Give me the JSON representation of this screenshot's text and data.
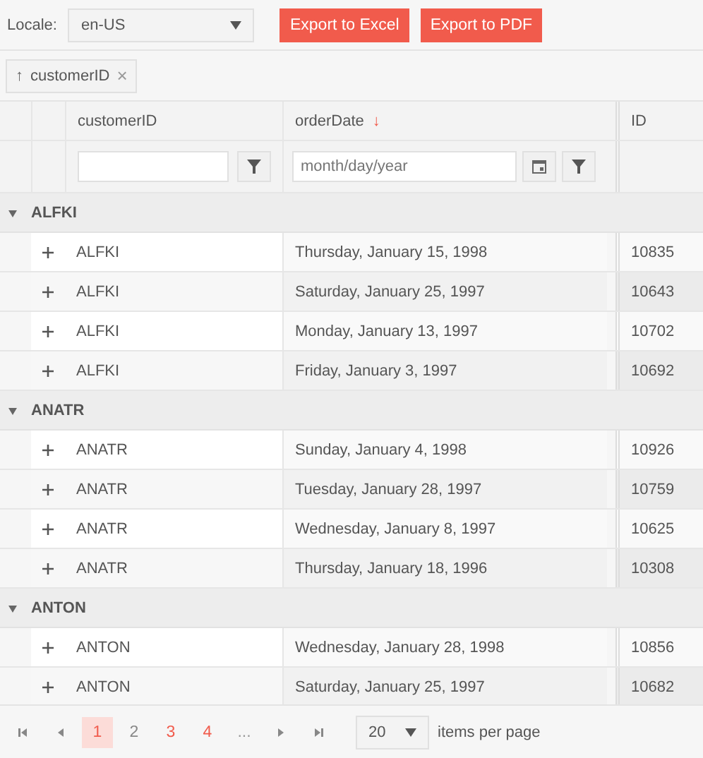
{
  "toolbar": {
    "locale_label": "Locale:",
    "locale_value": "en-US",
    "buttons": [
      "Export to Excel",
      "Export to PDF"
    ]
  },
  "group_panel": {
    "chips": [
      {
        "label": "customerID",
        "sort_icon": "↑",
        "remove_icon": "×"
      }
    ]
  },
  "columns": [
    {
      "title": "customerID"
    },
    {
      "title": "orderDate",
      "sort_icon": "↓"
    },
    {
      "title": "ID"
    }
  ],
  "filters": {
    "orderDate": {
      "placeholder": "month/day/year"
    }
  },
  "groups": [
    {
      "name": "ALFKI",
      "expanded": true,
      "rows": [
        {
          "customer": "ALFKI",
          "date": "Thursday, January 15, 1998",
          "id": "10835"
        },
        {
          "customer": "ALFKI",
          "date": "Saturday, January 25, 1997",
          "id": "10643"
        },
        {
          "customer": "ALFKI",
          "date": "Monday, January 13, 1997",
          "id": "10702"
        },
        {
          "customer": "ALFKI",
          "date": "Friday, January 3, 1997",
          "id": "10692"
        }
      ]
    },
    {
      "name": "ANATR",
      "expanded": true,
      "rows": [
        {
          "customer": "ANATR",
          "date": "Sunday, January 4, 1998",
          "id": "10926"
        },
        {
          "customer": "ANATR",
          "date": "Tuesday, January 28, 1997",
          "id": "10759"
        },
        {
          "customer": "ANATR",
          "date": "Wednesday, January 8, 1997",
          "id": "10625"
        },
        {
          "customer": "ANATR",
          "date": "Thursday, January 18, 1996",
          "id": "10308"
        }
      ]
    },
    {
      "name": "ANTON",
      "expanded": true,
      "rows": [
        {
          "customer": "ANTON",
          "date": "Wednesday, January 28, 1998",
          "id": "10856"
        },
        {
          "customer": "ANTON",
          "date": "Saturday, January 25, 1997",
          "id": "10682"
        }
      ]
    }
  ],
  "pager": {
    "pages": [
      {
        "label": "1",
        "selected": true,
        "color": "#f15b4c"
      },
      {
        "label": "2",
        "selected": false,
        "color": "#888888"
      },
      {
        "label": "3",
        "selected": false,
        "color": "#f15b4c"
      },
      {
        "label": "4",
        "selected": false,
        "color": "#f15b4c"
      }
    ],
    "more": "...",
    "page_size": "20",
    "page_size_label": "items per page"
  }
}
